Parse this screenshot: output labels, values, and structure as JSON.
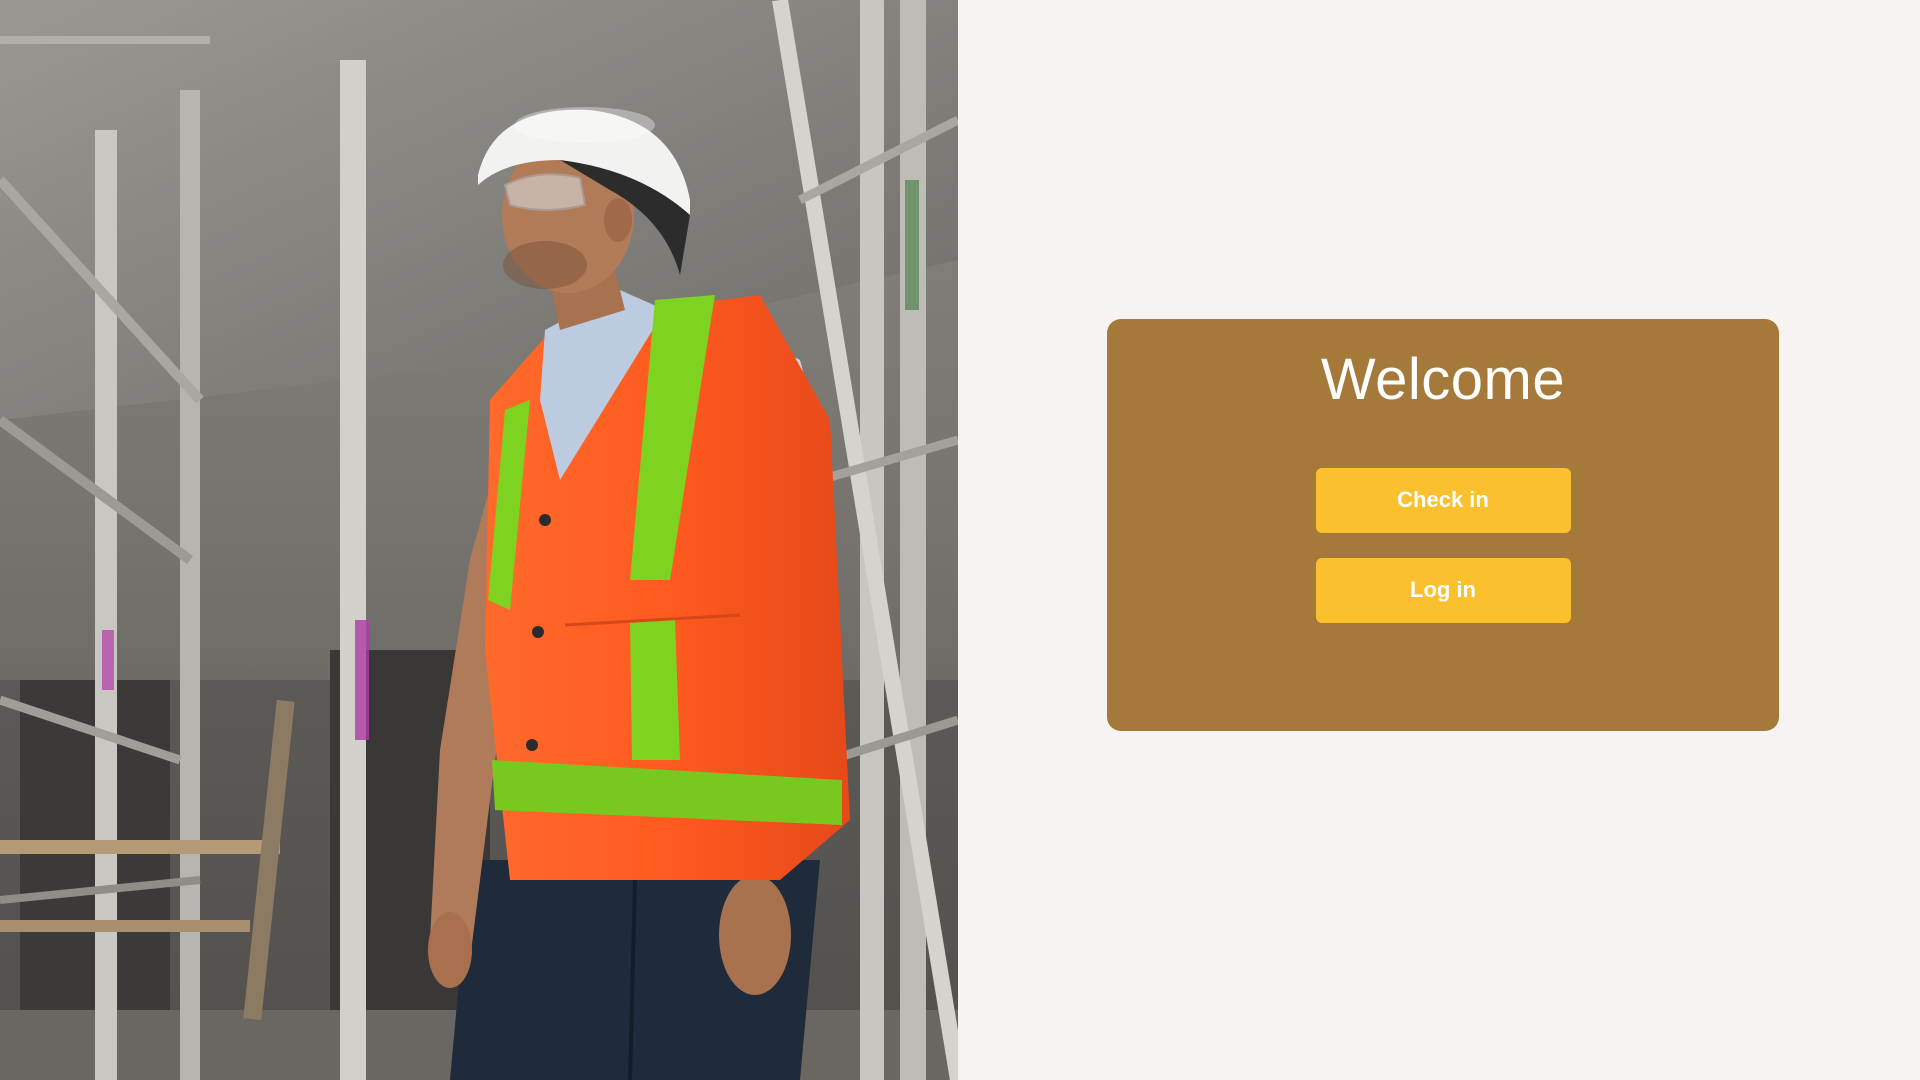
{
  "hero": {
    "image_description_icon": "construction-worker-photo",
    "colors": {
      "vest": "#ff5a1f",
      "reflective_tape": "#7ed321",
      "helmet": "#f2f2f0",
      "concrete": "#7d7a75"
    }
  },
  "welcome_card": {
    "title": "Welcome",
    "background_color": "#a47939",
    "buttons": {
      "check_in_label": "Check in",
      "log_in_label": "Log in",
      "button_color": "#fbc02d"
    }
  }
}
